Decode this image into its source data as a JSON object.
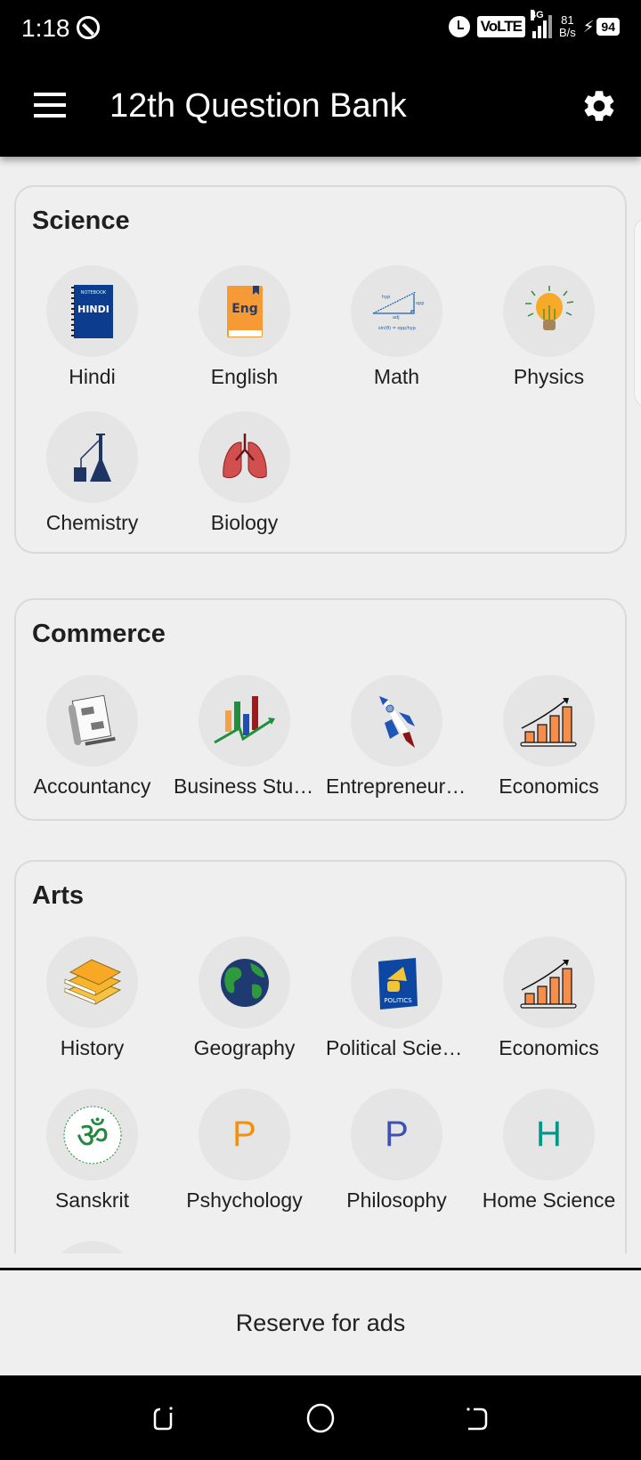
{
  "status_bar": {
    "time": "1:18",
    "network_type": "4G",
    "volte_label": "VoLTE",
    "net_speed_value": "81",
    "net_speed_unit": "B/s",
    "battery_level": "94"
  },
  "app_bar": {
    "title": "12th Question Bank",
    "menu_icon": "hamburger-menu-icon",
    "settings_icon": "gear-icon"
  },
  "sections": [
    {
      "title": "Science",
      "subjects": [
        {
          "label": "Hindi",
          "icon": "hindi-notebook-icon"
        },
        {
          "label": "English",
          "icon": "english-book-icon"
        },
        {
          "label": "Math",
          "icon": "trigonometry-icon"
        },
        {
          "label": "Physics",
          "icon": "light-bulb-icon"
        },
        {
          "label": "Chemistry",
          "icon": "lab-flask-icon"
        },
        {
          "label": "Biology",
          "icon": "lungs-icon"
        }
      ]
    },
    {
      "title": "Commerce",
      "subjects": [
        {
          "label": "Accountancy",
          "icon": "ledger-icon"
        },
        {
          "label": "Business Studies",
          "icon": "growth-chart-icon"
        },
        {
          "label": "Entrepreneurship",
          "icon": "rocket-icon"
        },
        {
          "label": "Economics",
          "icon": "bar-chart-icon"
        }
      ]
    },
    {
      "title": "Arts",
      "subjects": [
        {
          "label": "History",
          "icon": "books-stack-icon"
        },
        {
          "label": "Geography",
          "icon": "globe-icon"
        },
        {
          "label": "Political Science",
          "icon": "politics-book-icon"
        },
        {
          "label": "Economics",
          "icon": "bar-chart-icon"
        },
        {
          "label": "Sanskrit",
          "icon": "om-icon"
        },
        {
          "label": "Pshychology",
          "icon": "letter-avatar",
          "letter": "P",
          "letter_color": "#f5900a"
        },
        {
          "label": "Philosophy",
          "icon": "letter-avatar",
          "letter": "P",
          "letter_color": "#3f51b5"
        },
        {
          "label": "Home Science",
          "icon": "letter-avatar",
          "letter": "H",
          "letter_color": "#009688"
        }
      ]
    }
  ],
  "ads": {
    "label": "Reserve for ads"
  },
  "nav_bar": {
    "back": "back-icon",
    "home": "home-icon",
    "recents": "recents-icon"
  }
}
